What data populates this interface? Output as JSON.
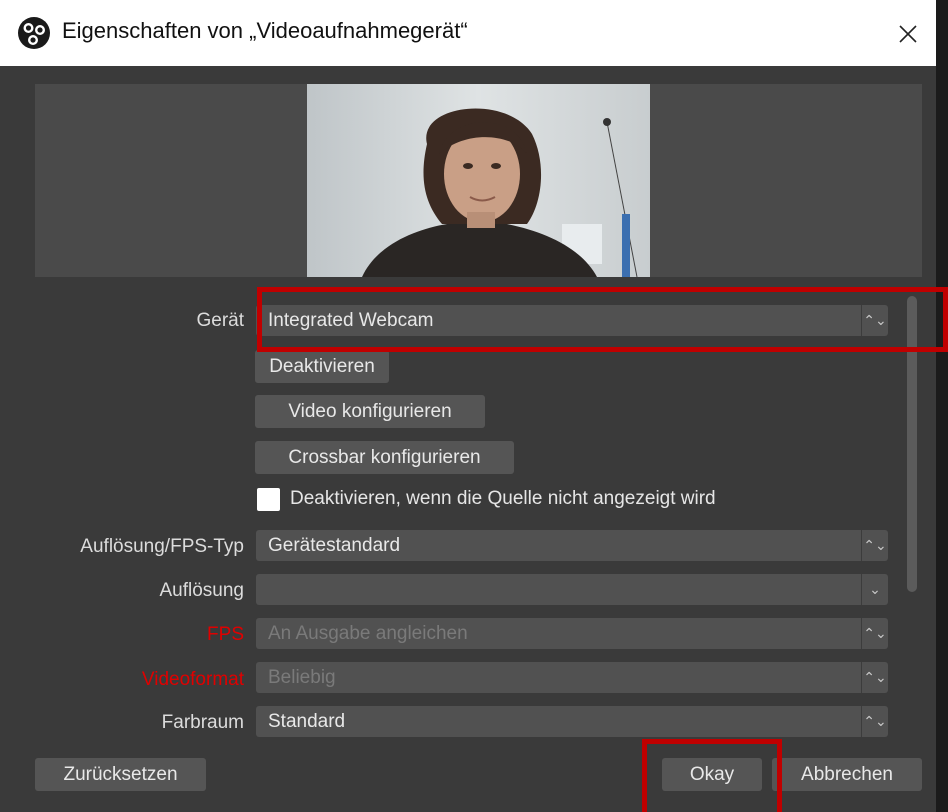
{
  "window": {
    "title": "Eigenschaften von „Videoaufnahmegerät“",
    "app_icon": "obs-logo-icon",
    "close_icon": "close-icon"
  },
  "preview": {
    "image": "webcam-preview"
  },
  "form": {
    "device": {
      "label": "Gerät",
      "value": "Integrated Webcam"
    },
    "buttons": {
      "deactivate": "Deaktivieren",
      "configure_video": "Video konfigurieren",
      "configure_crossbar": "Crossbar konfigurieren"
    },
    "deactivate_when_hidden": {
      "label": "Deaktivieren, wenn die Quelle nicht angezeigt wird",
      "checked": false
    },
    "resolution_fps_type": {
      "label": "Auflösung/FPS-Typ",
      "value": "Gerätestandard"
    },
    "resolution": {
      "label": "Auflösung",
      "value": ""
    },
    "fps": {
      "label": "FPS",
      "value": "An Ausgabe angleichen"
    },
    "video_format": {
      "label": "Videoformat",
      "value": "Beliebig"
    },
    "color_space": {
      "label": "Farbraum",
      "value": "Standard"
    }
  },
  "footer": {
    "reset": "Zurücksetzen",
    "ok": "Okay",
    "cancel": "Abbrechen"
  },
  "colors": {
    "background": "#3a3a3a",
    "control": "#515151",
    "error_label": "#e00000",
    "highlight": "#c00000"
  }
}
